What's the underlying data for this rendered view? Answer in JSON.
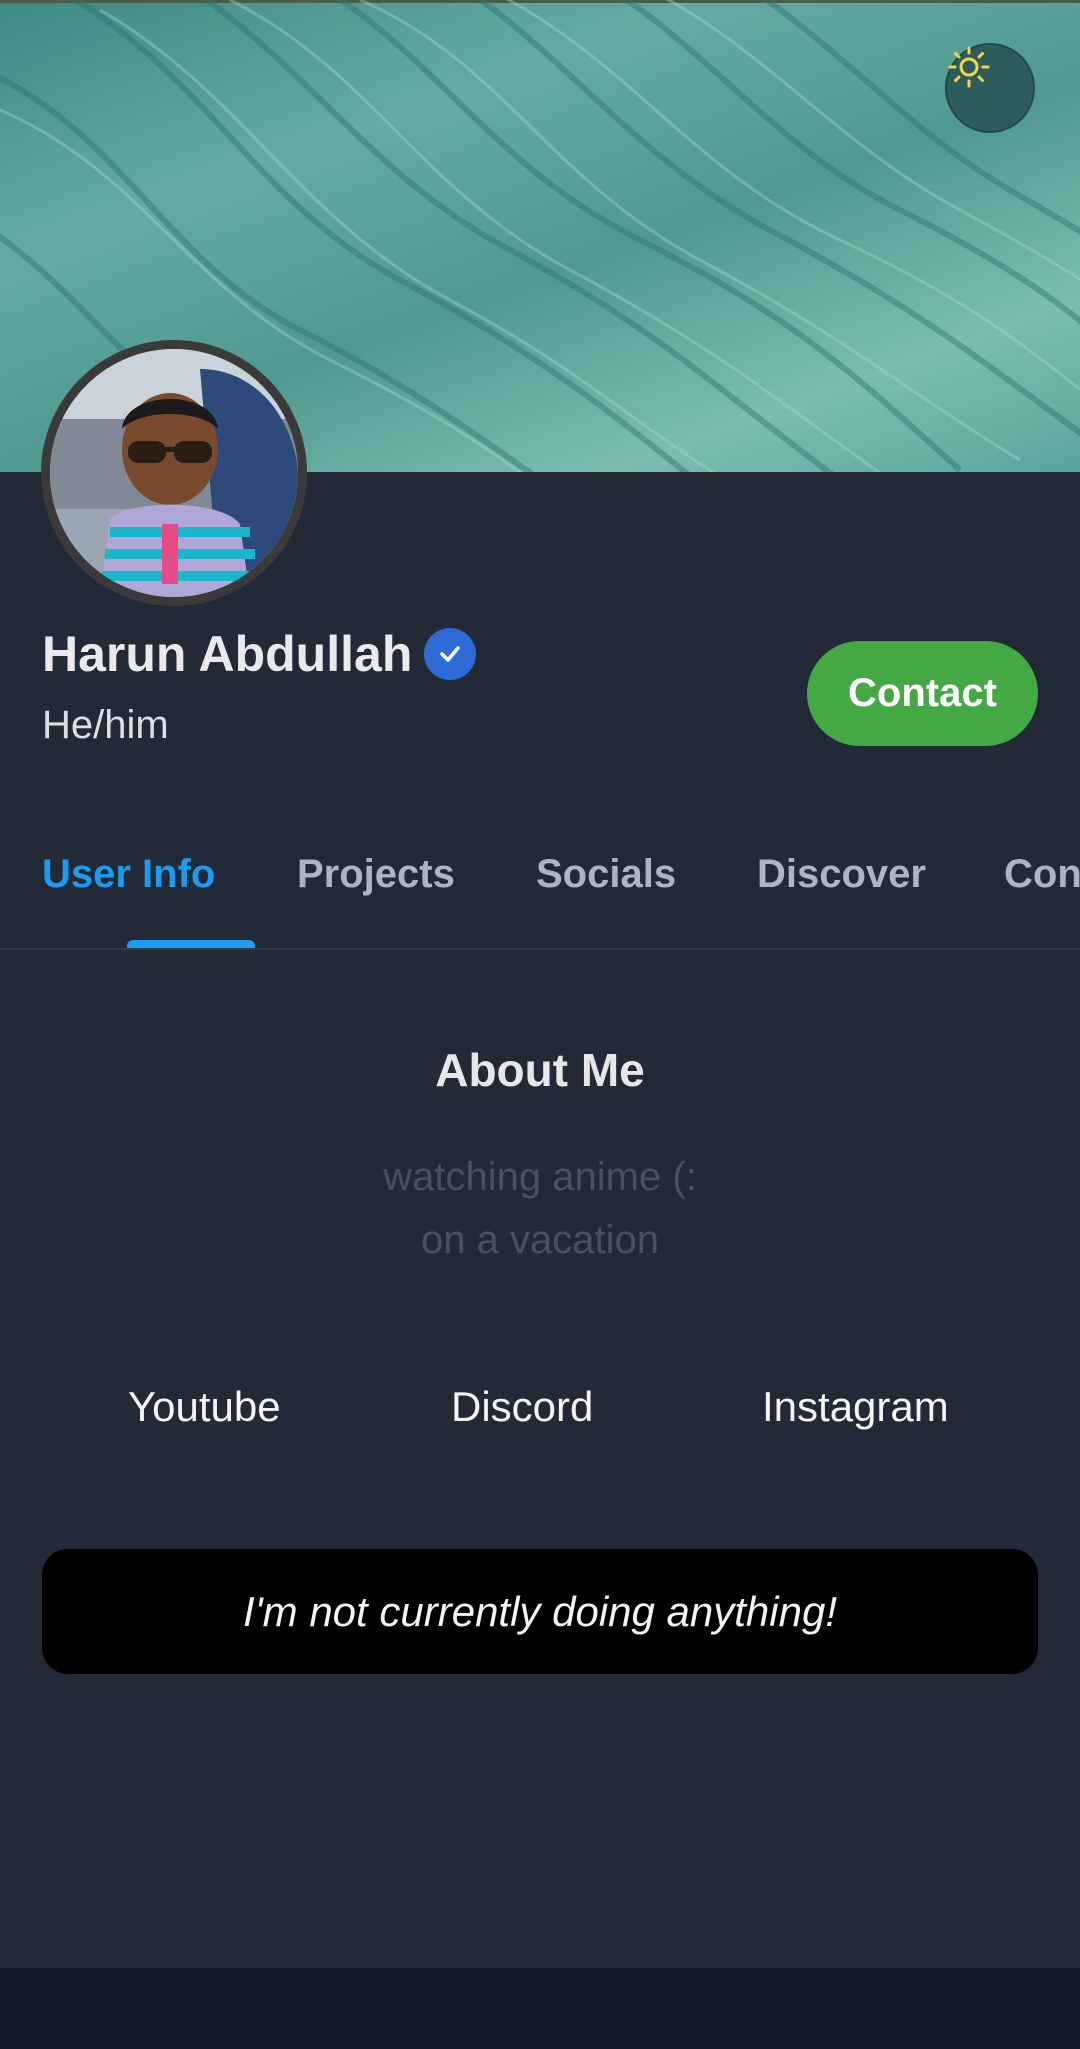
{
  "banner": {
    "image": "teal-sand-ripple-water-photo",
    "theme_toggle_icon": "sun-icon"
  },
  "profile": {
    "avatar": "profile-photo-boy-sunglasses",
    "name": "Harun Abdullah",
    "verified_icon": "verified-check-icon",
    "pronouns": "He/him",
    "contact_label": "Contact"
  },
  "tabs": [
    {
      "label": "User Info",
      "active": true
    },
    {
      "label": "Projects",
      "active": false
    },
    {
      "label": "Socials",
      "active": false
    },
    {
      "label": "Discover",
      "active": false
    },
    {
      "label": "Con",
      "active": false
    }
  ],
  "about": {
    "title": "About Me",
    "lines": [
      "watching anime (:",
      "on a vacation"
    ]
  },
  "socials": [
    {
      "label": "Youtube"
    },
    {
      "label": "Discord"
    },
    {
      "label": "Instagram"
    }
  ],
  "status": {
    "text": "I'm not currently doing anything!"
  },
  "colors": {
    "accent": "#1e9bf0",
    "contact_button": "#44a944",
    "background": "#222a38",
    "verified": "#2f6bd6"
  }
}
